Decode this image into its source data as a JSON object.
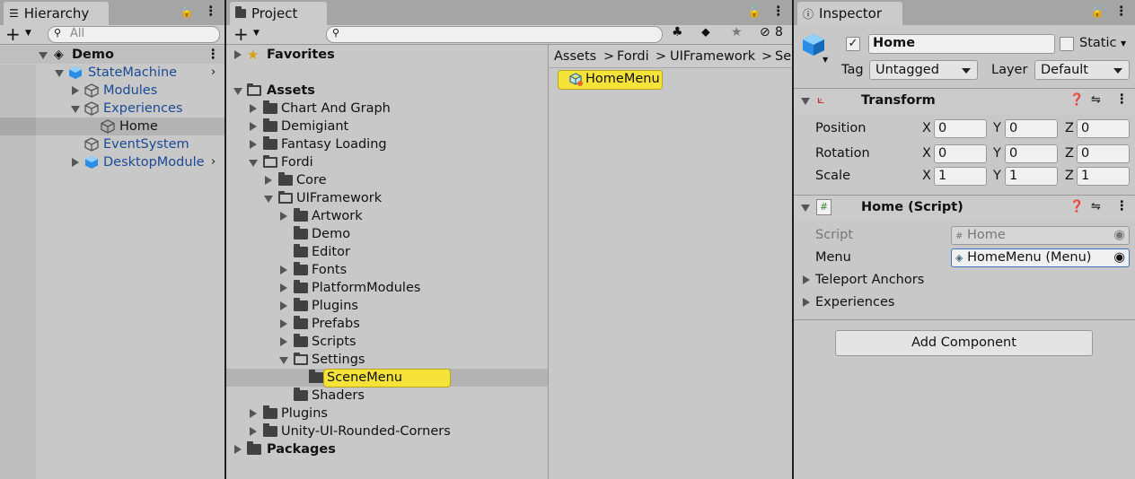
{
  "hierarchy": {
    "tab_label": "Hierarchy",
    "search_placeholder": "All",
    "scene": "Demo",
    "items": [
      {
        "label": "StateMachine"
      },
      {
        "label": "Modules"
      },
      {
        "label": "Experiences"
      },
      {
        "label": "Home"
      },
      {
        "label": "EventSystem"
      },
      {
        "label": "DesktopModule"
      }
    ]
  },
  "project": {
    "tab_label": "Project",
    "hidden_count": "8",
    "favorites": "Favorites",
    "assets": "Assets",
    "tree": [
      {
        "label": "Chart And Graph"
      },
      {
        "label": "Demigiant"
      },
      {
        "label": "Fantasy Loading"
      },
      {
        "label": "Fordi"
      },
      {
        "label": "Core"
      },
      {
        "label": "UIFramework"
      },
      {
        "label": "Artwork"
      },
      {
        "label": "Demo"
      },
      {
        "label": "Editor"
      },
      {
        "label": "Fonts"
      },
      {
        "label": "PlatformModules"
      },
      {
        "label": "Plugins"
      },
      {
        "label": "Prefabs"
      },
      {
        "label": "Scripts"
      },
      {
        "label": "Settings"
      },
      {
        "label": "SceneMenu"
      },
      {
        "label": "Shaders"
      },
      {
        "label": "Plugins"
      },
      {
        "label": "Unity-UI-Rounded-Corners"
      }
    ],
    "packages": "Packages",
    "breadcrumb": [
      "Assets",
      "Fordi",
      "UIFramework",
      "Se"
    ],
    "breadcrumb_sep": ">",
    "asset_item": "HomeMenu"
  },
  "inspector": {
    "tab_label": "Inspector",
    "object_name": "Home",
    "static_label": "Static",
    "tag_label": "Tag",
    "tag_value": "Untagged",
    "layer_label": "Layer",
    "layer_value": "Default",
    "transform": {
      "title": "Transform",
      "position_label": "Position",
      "rotation_label": "Rotation",
      "scale_label": "Scale",
      "x": "X",
      "y": "Y",
      "z": "Z",
      "position": [
        "0",
        "0",
        "0"
      ],
      "rotation": [
        "0",
        "0",
        "0"
      ],
      "scale": [
        "1",
        "1",
        "1"
      ]
    },
    "script_component": {
      "title": "Home (Script)",
      "script_label": "Script",
      "script_value": "Home",
      "menu_label": "Menu",
      "menu_value": "HomeMenu (Menu)",
      "teleport_label": "Teleport Anchors",
      "experiences_label": "Experiences"
    },
    "add_component": "Add Component"
  },
  "colors": {
    "accent_blue": "#1a4a94",
    "highlight_yellow": "#f5e33a"
  }
}
